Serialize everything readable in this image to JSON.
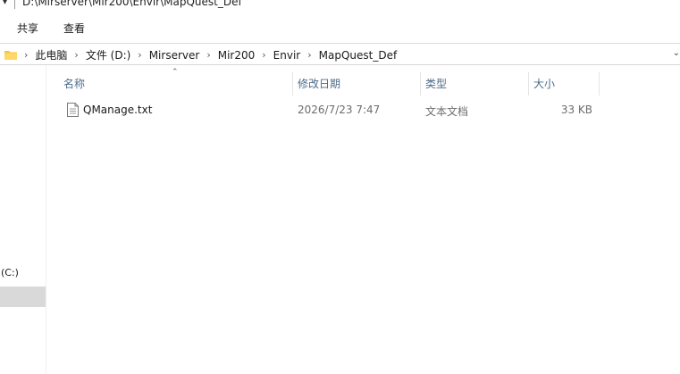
{
  "window": {
    "title_path": "D:\\Mirserver\\Mir200\\Envir\\MapQuest_Def"
  },
  "ribbon": {
    "tabs": [
      "共享",
      "查看"
    ]
  },
  "address": {
    "crumbs": [
      "此电脑",
      "文件 (D:)",
      "Mirserver",
      "Mir200",
      "Envir",
      "MapQuest_Def"
    ]
  },
  "nav": {
    "drive_label": "(C:)"
  },
  "columns": {
    "name": "名称",
    "modified": "修改日期",
    "type": "类型",
    "size": "大小"
  },
  "files": [
    {
      "name": "QManage.txt",
      "modified": "2026/7/23 7:47",
      "type": "文本文档",
      "size": "33 KB",
      "icon": "text-file-icon"
    }
  ],
  "colors": {
    "header_text": "#4d6b8a",
    "selection": "#d9d9d9",
    "folder": "#f5c443"
  }
}
